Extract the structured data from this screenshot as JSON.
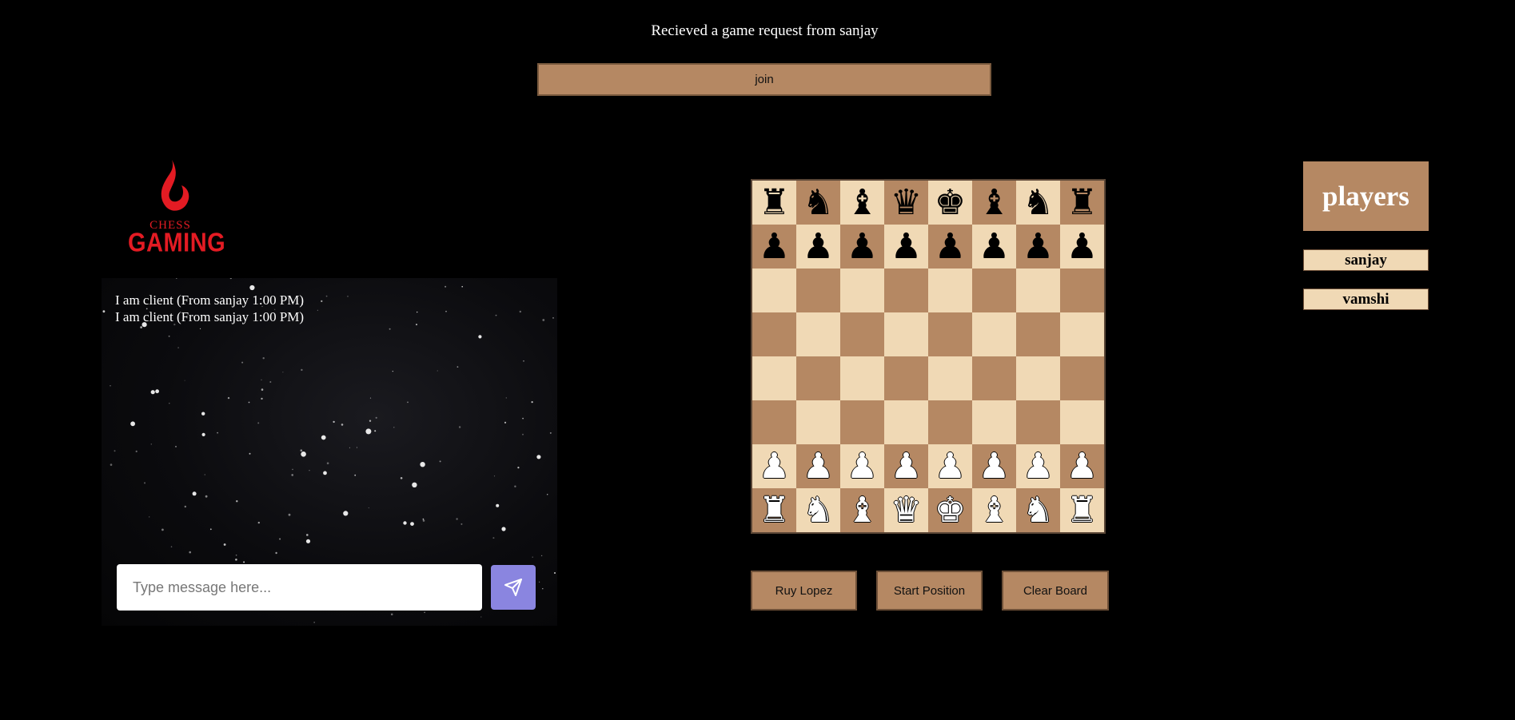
{
  "notice": "Recieved a game request from sanjay",
  "join_label": "join",
  "logo": {
    "small": "CHESS",
    "big": "GAMING"
  },
  "chat": {
    "messages": [
      "I am client (From sanjay 1:00 PM)",
      "I am client (From sanjay 1:00 PM)"
    ],
    "input_placeholder": "Type message here...",
    "input_value": "",
    "send_icon": "send-icon"
  },
  "board": {
    "ranks": [
      [
        "r",
        "n",
        "b",
        "q",
        "k",
        "b",
        "n",
        "r"
      ],
      [
        "p",
        "p",
        "p",
        "p",
        "p",
        "p",
        "p",
        "p"
      ],
      [
        "",
        "",
        "",
        "",
        "",
        "",
        "",
        ""
      ],
      [
        "",
        "",
        "",
        "",
        "",
        "",
        "",
        ""
      ],
      [
        "",
        "",
        "",
        "",
        "",
        "",
        "",
        ""
      ],
      [
        "",
        "",
        "",
        "",
        "",
        "",
        "",
        ""
      ],
      [
        "P",
        "P",
        "P",
        "P",
        "P",
        "P",
        "P",
        "P"
      ],
      [
        "R",
        "N",
        "B",
        "Q",
        "K",
        "B",
        "N",
        "R"
      ]
    ],
    "light_color": "#f0d9b5",
    "dark_color": "#b58863"
  },
  "buttons": {
    "ruy_lopez": "Ruy Lopez",
    "start": "Start Position",
    "clear": "Clear Board"
  },
  "players": {
    "title": "players",
    "list": [
      "sanjay",
      "vamshi"
    ]
  },
  "colors": {
    "accent": "#b58863",
    "logo_red": "#e31b23",
    "send_button": "#8a85e0"
  }
}
